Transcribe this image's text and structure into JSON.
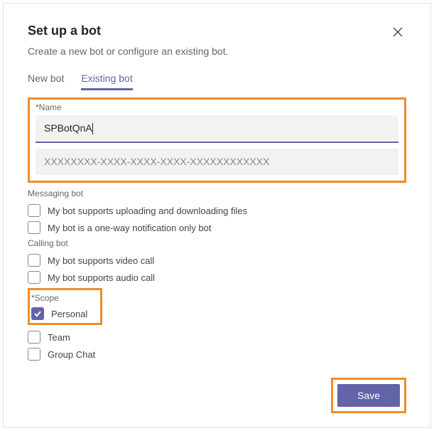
{
  "dialog": {
    "title": "Set up a bot",
    "subtitle": "Create a new bot or configure an existing bot."
  },
  "tabs": {
    "new": "New bot",
    "existing": "Existing bot"
  },
  "name_section": {
    "label": "*Name",
    "value": "SPBotQnA",
    "id_value": "XXXXXXXX-XXXX-XXXX-XXXX-XXXXXXXXXXXX"
  },
  "messaging": {
    "label": "Messaging bot",
    "upload": "My bot supports uploading and downloading files",
    "oneway": "My bot is a one-way notification only bot"
  },
  "calling": {
    "label": "Calling bot",
    "video": "My bot supports video call",
    "audio": "My bot supports audio call"
  },
  "scope": {
    "label": "*Scope",
    "personal": "Personal",
    "team": "Team",
    "group": "Group Chat"
  },
  "footer": {
    "save": "Save"
  }
}
